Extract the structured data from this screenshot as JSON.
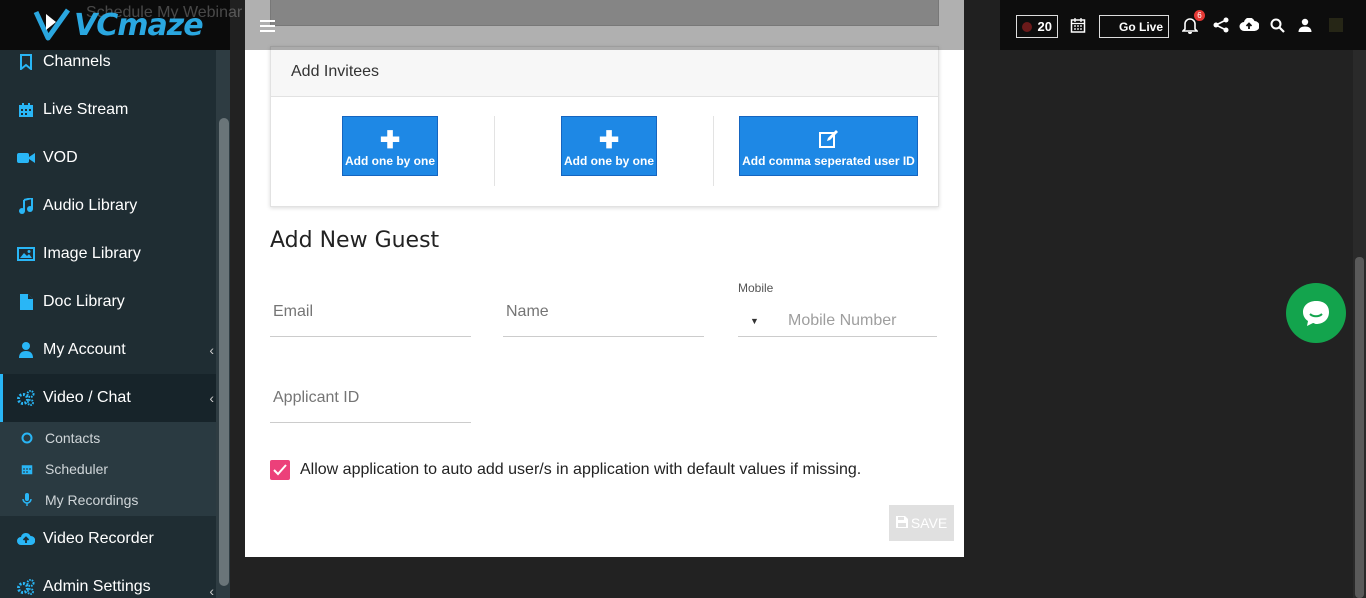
{
  "header": {
    "logo_text": "VCmaze",
    "ghost_text": "Schedule My Webinar",
    "counter": "20",
    "go_live_label": "Go Live",
    "notification_count": "6"
  },
  "sidebar": {
    "items": [
      {
        "label": "Channels",
        "icon": "bookmark-icon"
      },
      {
        "label": "Live Stream",
        "icon": "calendar-icon"
      },
      {
        "label": "VOD",
        "icon": "video-camera-icon"
      },
      {
        "label": "Audio Library",
        "icon": "music-icon"
      },
      {
        "label": "Image Library",
        "icon": "image-icon"
      },
      {
        "label": "Doc Library",
        "icon": "document-icon"
      },
      {
        "label": "My Account",
        "icon": "user-icon"
      },
      {
        "label": "Video / Chat",
        "icon": "cogs-icon"
      },
      {
        "label": "Video Recorder",
        "icon": "cloud-upload-icon"
      },
      {
        "label": "Admin Settings",
        "icon": "cogs-icon"
      }
    ],
    "sub_items": [
      {
        "label": "Contacts",
        "icon": "circle-icon"
      },
      {
        "label": "Scheduler",
        "icon": "calendar-icon"
      },
      {
        "label": "My Recordings",
        "icon": "microphone-icon"
      }
    ]
  },
  "invitees": {
    "title": "Add Invitees",
    "buttons": [
      {
        "label": "Add one by one",
        "icon": "plus-icon"
      },
      {
        "label": "Add one by one",
        "icon": "plus-icon"
      },
      {
        "label": "Add comma seperated user ID",
        "icon": "edit-icon"
      }
    ]
  },
  "guest_form": {
    "title": "Add New Guest",
    "email_placeholder": "Email",
    "name_placeholder": "Name",
    "mobile_label": "Mobile",
    "mobile_placeholder": "Mobile Number",
    "applicant_placeholder": "Applicant ID",
    "auto_add_label": "Allow application to auto add user/s in application with default values if missing.",
    "auto_add_checked": true,
    "save_label": "SAVE"
  },
  "colors": {
    "accent": "#1e88e5",
    "sidebar_bg": "#1f2d33",
    "checkbox": "#ec407a",
    "chat_fab": "#13a44d"
  }
}
